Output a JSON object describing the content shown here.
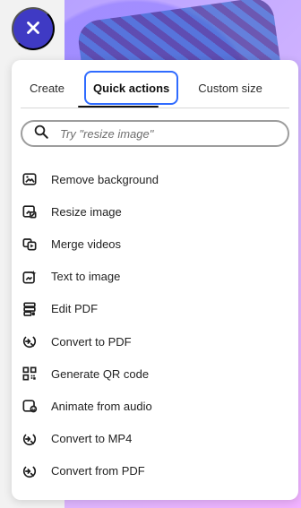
{
  "close_button": {
    "icon": "close-icon",
    "color": "#3f3ac4"
  },
  "tabs": [
    {
      "label": "Create"
    },
    {
      "label": "Quick actions"
    },
    {
      "label": "Custom size"
    }
  ],
  "search": {
    "placeholder": "Try \"resize image\"",
    "value": ""
  },
  "quick_actions": [
    {
      "label": "Remove background",
      "icon": "remove-background-icon"
    },
    {
      "label": "Resize image",
      "icon": "resize-image-icon"
    },
    {
      "label": "Merge videos",
      "icon": "merge-videos-icon"
    },
    {
      "label": "Text to image",
      "icon": "text-to-image-icon"
    },
    {
      "label": "Edit PDF",
      "icon": "edit-pdf-icon"
    },
    {
      "label": "Convert to PDF",
      "icon": "convert-to-pdf-icon"
    },
    {
      "label": "Generate QR code",
      "icon": "qr-code-icon"
    },
    {
      "label": "Animate from audio",
      "icon": "animate-from-audio-icon"
    },
    {
      "label": "Convert to MP4",
      "icon": "convert-to-mp4-icon"
    },
    {
      "label": "Convert from PDF",
      "icon": "convert-from-pdf-icon"
    }
  ],
  "colors": {
    "accent": "#2f6bff",
    "panel_bg": "#ffffff",
    "text": "#222222"
  }
}
